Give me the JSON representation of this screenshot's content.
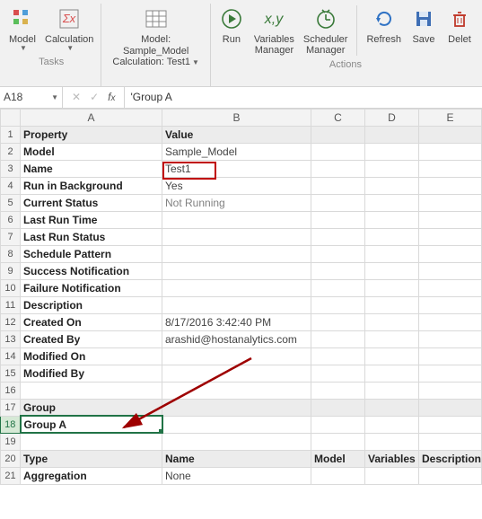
{
  "ribbon": {
    "tasks_label": "Tasks",
    "actions_label": "Actions",
    "model_btn": "Model",
    "calc_btn": "Calculation",
    "picker_line1": "Model: Sample_Model",
    "picker_line2": "Calculation: Test1",
    "run_btn": "Run",
    "vars_btn_l1": "Variables",
    "vars_btn_l2": "Manager",
    "sched_btn_l1": "Scheduler",
    "sched_btn_l2": "Manager",
    "refresh_btn": "Refresh",
    "save_btn": "Save",
    "delete_btn": "Delet"
  },
  "formula_bar": {
    "cell_ref": "A18",
    "formula": "'Group A"
  },
  "columns": [
    "A",
    "B",
    "C",
    "D",
    "E"
  ],
  "rows": [
    {
      "n": 1,
      "hdr": true,
      "a": "Property",
      "b": "Value",
      "c": "",
      "d": "",
      "e": ""
    },
    {
      "n": 2,
      "a": "Model",
      "b": "Sample_Model"
    },
    {
      "n": 3,
      "a": "Name",
      "b": "Test1"
    },
    {
      "n": 4,
      "a": "Run in Background",
      "b": "Yes"
    },
    {
      "n": 5,
      "a": "Current Status",
      "b": "Not Running",
      "bgrey": true
    },
    {
      "n": 6,
      "a": "Last Run Time",
      "b": ""
    },
    {
      "n": 7,
      "a": "Last Run Status",
      "b": ""
    },
    {
      "n": 8,
      "a": "Schedule Pattern",
      "b": ""
    },
    {
      "n": 9,
      "a": "Success Notification",
      "b": ""
    },
    {
      "n": 10,
      "a": "Failure Notification",
      "b": ""
    },
    {
      "n": 11,
      "a": "Description",
      "b": ""
    },
    {
      "n": 12,
      "a": "Created On",
      "b": "8/17/2016 3:42:40 PM"
    },
    {
      "n": 13,
      "a": "Created By",
      "b": "arashid@hostanalytics.com"
    },
    {
      "n": 14,
      "a": "Modified On",
      "b": ""
    },
    {
      "n": 15,
      "a": "Modified By",
      "b": ""
    },
    {
      "n": 16,
      "a": "",
      "b": ""
    },
    {
      "n": 17,
      "hdr": true,
      "a": "Group",
      "b": "",
      "c": "",
      "d": "",
      "e": ""
    },
    {
      "n": 18,
      "a": "Group A",
      "b": "",
      "sel": true
    },
    {
      "n": 19,
      "a": "",
      "b": ""
    },
    {
      "n": 20,
      "hdr": true,
      "a": "Type",
      "b": "Name",
      "c": "Model",
      "d": "Variables",
      "e": "Description"
    },
    {
      "n": 21,
      "a": "Aggregation",
      "b": "None"
    }
  ]
}
